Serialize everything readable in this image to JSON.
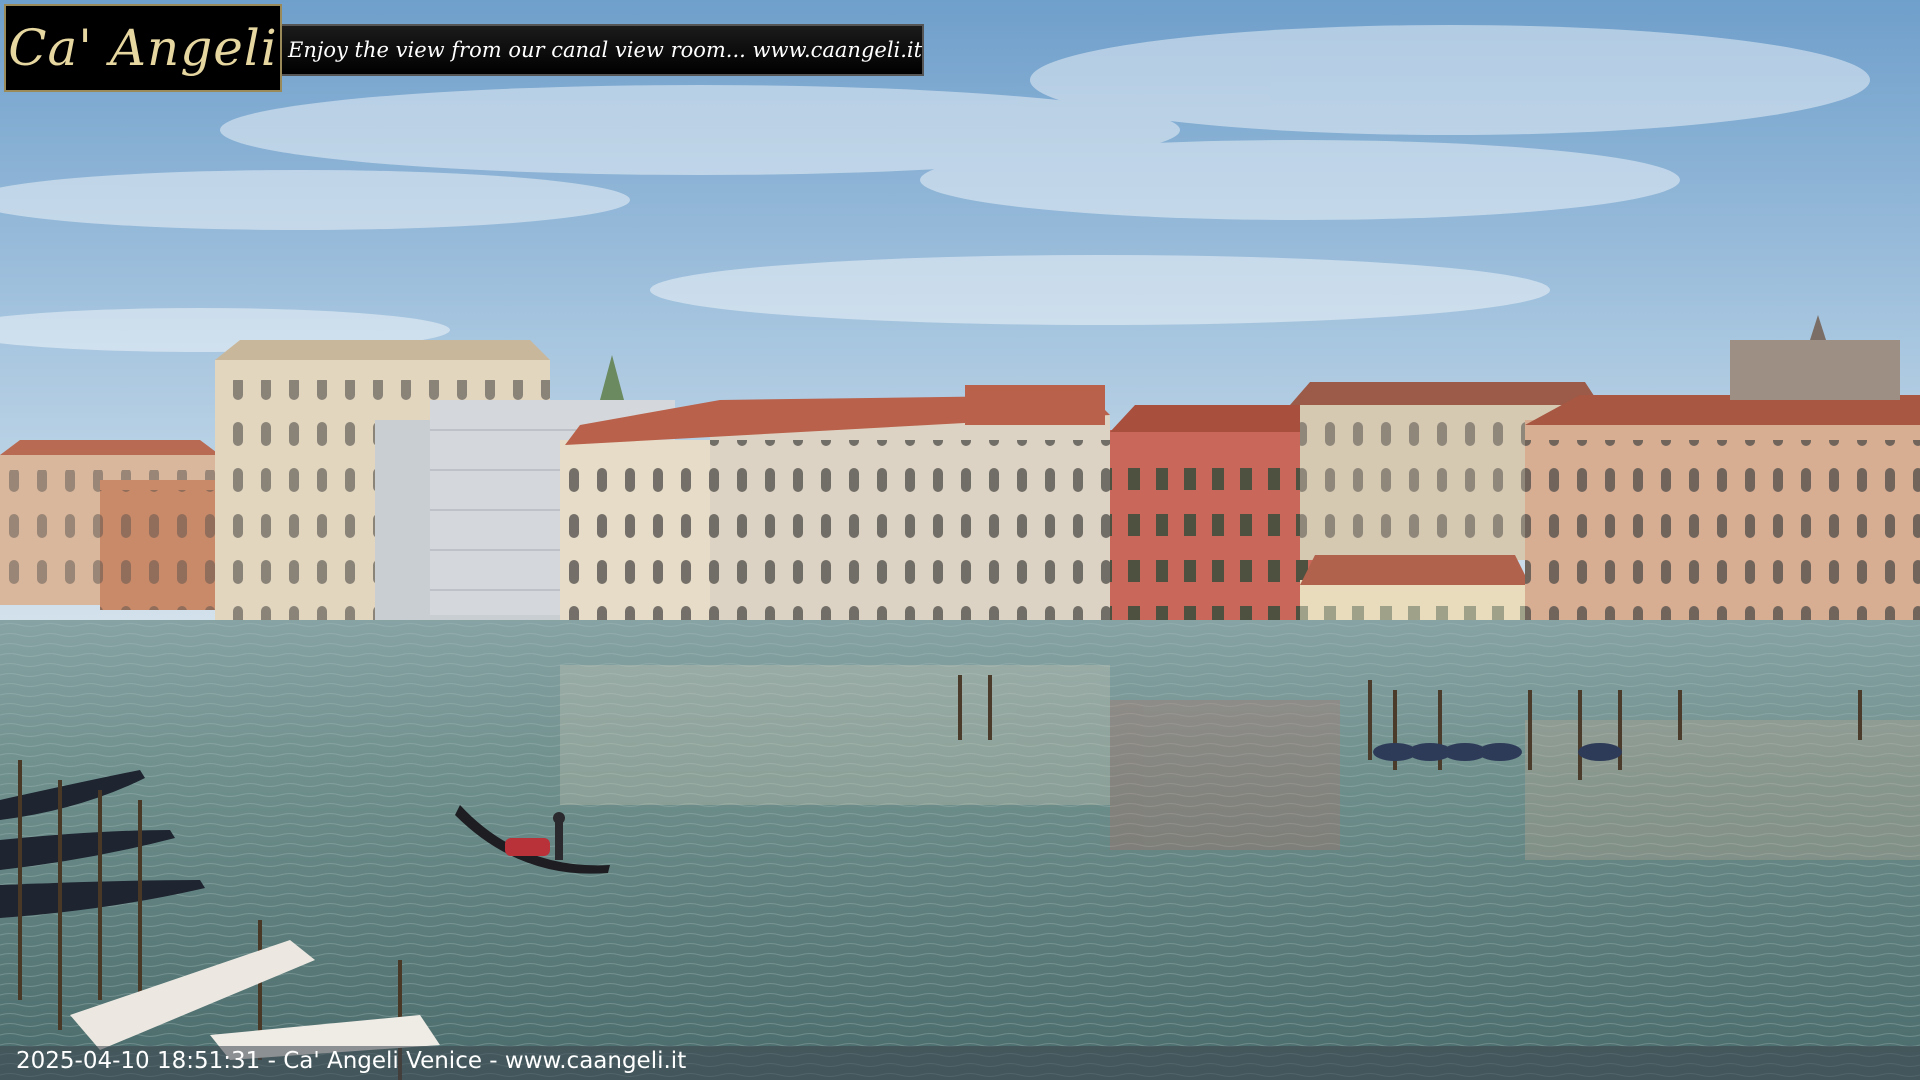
{
  "overlay": {
    "logo_text": "Ca' Angeli",
    "tagline": "Enjoy the view from our canal view room... www.caangeli.it"
  },
  "footer": {
    "timestamp_caption": "2025-04-10 18:51:31 - Ca' Angeli Venice - www.caangeli.it"
  },
  "colors": {
    "sky_top": "#7fa8cc",
    "sky_bottom": "#c9dceb",
    "water": "#5d7f7c",
    "palazzo_red": "#c9675a",
    "palazzo_cream": "#e4d6bd",
    "palazzo_pink": "#d8ae93",
    "roof": "#b9614a",
    "logo_gold": "#e6d6a0"
  }
}
